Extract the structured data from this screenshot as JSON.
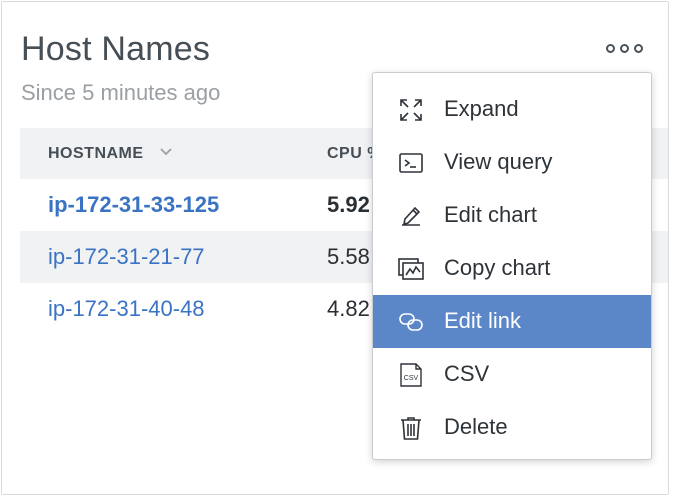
{
  "widget": {
    "title": "Host Names",
    "subtitle": "Since 5 minutes ago"
  },
  "table": {
    "columns": [
      "HOSTNAME",
      "CPU %"
    ],
    "sort_column": "HOSTNAME",
    "rows": [
      {
        "hostname": "ip-172-31-33-125",
        "cpu": "5.92",
        "bold": true
      },
      {
        "hostname": "ip-172-31-21-77",
        "cpu": "5.58",
        "bold": false
      },
      {
        "hostname": "ip-172-31-40-48",
        "cpu": "4.82",
        "bold": false
      }
    ]
  },
  "menu": {
    "items": [
      {
        "label": "Expand",
        "icon": "expand-icon"
      },
      {
        "label": "View query",
        "icon": "terminal-icon"
      },
      {
        "label": "Edit chart",
        "icon": "pencil-icon"
      },
      {
        "label": "Copy chart",
        "icon": "copy-chart-icon"
      },
      {
        "label": "Edit link",
        "icon": "link-icon",
        "active": true
      },
      {
        "label": "CSV",
        "icon": "csv-file-icon",
        "icon_text": "CSV"
      },
      {
        "label": "Delete",
        "icon": "trash-icon"
      }
    ]
  },
  "colors": {
    "link": "#3b73c4",
    "menu_highlight": "#5b87c9",
    "header_bg": "#f1f2f3"
  }
}
